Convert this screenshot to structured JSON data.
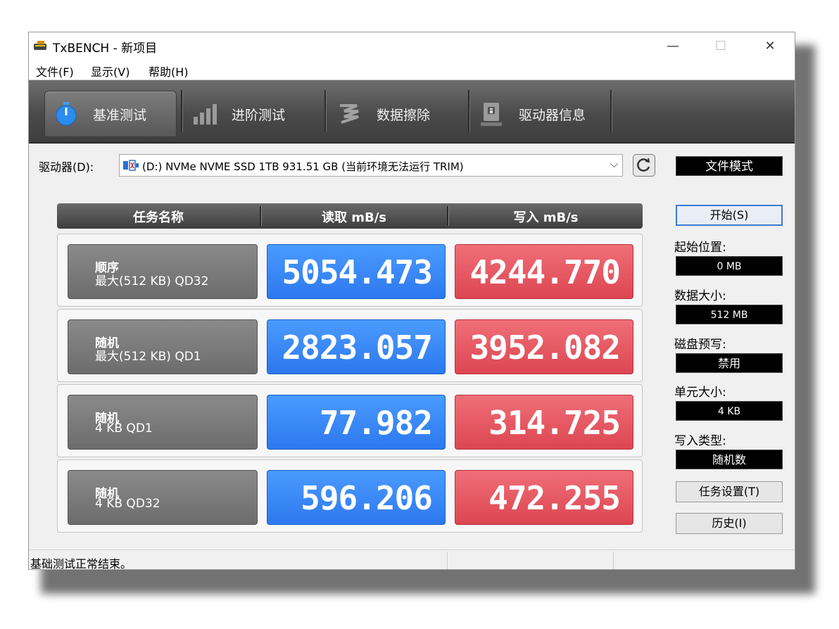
{
  "window": {
    "title": "TxBENCH - 新项目",
    "controls": {
      "minimize": "—",
      "maximize": "☐",
      "close": "✕"
    }
  },
  "menu": [
    "文件(F)",
    "显示(V)",
    "帮助(H)"
  ],
  "tabs": [
    {
      "label": "基准测试",
      "icon": "stopwatch-icon",
      "active": true
    },
    {
      "label": "进阶测试",
      "icon": "bar-chart-icon",
      "active": false
    },
    {
      "label": "数据擦除",
      "icon": "eraser-icon",
      "active": false
    },
    {
      "label": "驱动器信息",
      "icon": "drive-info-icon",
      "active": false
    }
  ],
  "drive": {
    "label": "驱动器(D):",
    "selected": "(D:) NVMe NVME SSD 1TB  931.51 GB (当前环境无法运行 TRIM)",
    "icon": "ssd-icon"
  },
  "results": {
    "headers": {
      "task": "任务名称",
      "read": "读取 mB/s",
      "write": "写入 mB/s"
    },
    "rows": [
      {
        "line1": "顺序",
        "line2": "最大(512 KB) QD32",
        "read": "5054.473",
        "write": "4244.770"
      },
      {
        "line1": "随机",
        "line2": "最大(512 KB) QD1",
        "read": "2823.057",
        "write": "3952.082"
      },
      {
        "line1": "随机",
        "line2": "4 KB QD1",
        "read": "77.982",
        "write": "314.725"
      },
      {
        "line1": "随机",
        "line2": "4 KB QD32",
        "read": "596.206",
        "write": "472.255"
      }
    ]
  },
  "panel": {
    "file_mode": "文件模式",
    "start": "开始(S)",
    "start_pos_label": "起始位置:",
    "start_pos": "0 MB",
    "data_size_label": "数据大小:",
    "data_size": "512 MB",
    "precond_label": "磁盘预写:",
    "precond": "禁用",
    "unit_size_label": "单元大小:",
    "unit_size": "4 KB",
    "write_type_label": "写入类型:",
    "write_type": "随机数",
    "task_settings": "任务设置(T)",
    "history": "历史(I)"
  },
  "status": "基础测试正常结束。",
  "colors": {
    "read": "#2d78ee",
    "write": "#dc4651",
    "toolbar": "#4a4a4a"
  }
}
